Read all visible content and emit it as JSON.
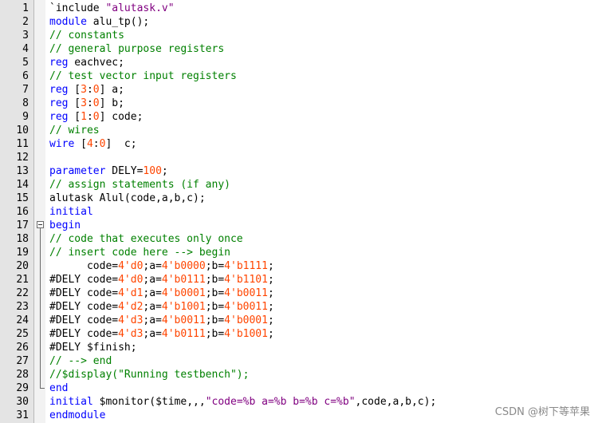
{
  "editor": {
    "language": "verilog",
    "lines": [
      {
        "n": "1",
        "fold": "",
        "tokens": [
          [
            "tx",
            "`include "
          ],
          [
            "str",
            "\"alutask.v\""
          ]
        ]
      },
      {
        "n": "2",
        "fold": "",
        "tokens": [
          [
            "kw",
            "module"
          ],
          [
            "tx",
            " alu_tp();"
          ]
        ]
      },
      {
        "n": "3",
        "fold": "",
        "tokens": [
          [
            "cm",
            "// constants"
          ]
        ]
      },
      {
        "n": "4",
        "fold": "",
        "tokens": [
          [
            "cm",
            "// general purpose registers"
          ]
        ]
      },
      {
        "n": "5",
        "fold": "",
        "tokens": [
          [
            "kw",
            "reg"
          ],
          [
            "tx",
            " eachvec;"
          ]
        ]
      },
      {
        "n": "6",
        "fold": "",
        "tokens": [
          [
            "cm",
            "// test vector input registers"
          ]
        ]
      },
      {
        "n": "7",
        "fold": "",
        "tokens": [
          [
            "kw",
            "reg"
          ],
          [
            "tx",
            " ["
          ],
          [
            "num",
            "3"
          ],
          [
            "tx",
            ":"
          ],
          [
            "num",
            "0"
          ],
          [
            "tx",
            "] a;"
          ]
        ]
      },
      {
        "n": "8",
        "fold": "",
        "tokens": [
          [
            "kw",
            "reg"
          ],
          [
            "tx",
            " ["
          ],
          [
            "num",
            "3"
          ],
          [
            "tx",
            ":"
          ],
          [
            "num",
            "0"
          ],
          [
            "tx",
            "] b;"
          ]
        ]
      },
      {
        "n": "9",
        "fold": "",
        "tokens": [
          [
            "kw",
            "reg"
          ],
          [
            "tx",
            " ["
          ],
          [
            "num",
            "1"
          ],
          [
            "tx",
            ":"
          ],
          [
            "num",
            "0"
          ],
          [
            "tx",
            "] code;"
          ]
        ]
      },
      {
        "n": "10",
        "fold": "",
        "tokens": [
          [
            "cm",
            "// wires"
          ]
        ]
      },
      {
        "n": "11",
        "fold": "",
        "tokens": [
          [
            "kw",
            "wire"
          ],
          [
            "tx",
            " ["
          ],
          [
            "num",
            "4"
          ],
          [
            "tx",
            ":"
          ],
          [
            "num",
            "0"
          ],
          [
            "tx",
            "]  c;"
          ]
        ]
      },
      {
        "n": "12",
        "fold": "",
        "tokens": []
      },
      {
        "n": "13",
        "fold": "",
        "tokens": [
          [
            "kw",
            "parameter"
          ],
          [
            "tx",
            " DELY="
          ],
          [
            "num",
            "100"
          ],
          [
            "tx",
            ";"
          ]
        ]
      },
      {
        "n": "14",
        "fold": "",
        "tokens": [
          [
            "cm",
            "// assign statements (if any)"
          ]
        ]
      },
      {
        "n": "15",
        "fold": "",
        "tokens": [
          [
            "tx",
            "alutask Alul(code,a,b,c);"
          ]
        ]
      },
      {
        "n": "16",
        "fold": "",
        "tokens": [
          [
            "kw",
            "initial"
          ]
        ]
      },
      {
        "n": "17",
        "fold": "open",
        "tokens": [
          [
            "kw",
            "begin"
          ]
        ]
      },
      {
        "n": "18",
        "fold": "line",
        "tokens": [
          [
            "cm",
            "// code that executes only once"
          ]
        ]
      },
      {
        "n": "19",
        "fold": "line",
        "tokens": [
          [
            "cm",
            "// insert code here --> begin"
          ]
        ]
      },
      {
        "n": "20",
        "fold": "line",
        "tokens": [
          [
            "tx",
            "      code="
          ],
          [
            "num",
            "4'd0"
          ],
          [
            "tx",
            ";a="
          ],
          [
            "num",
            "4'b0000"
          ],
          [
            "tx",
            ";b="
          ],
          [
            "num",
            "4'b1111"
          ],
          [
            "tx",
            ";"
          ]
        ]
      },
      {
        "n": "21",
        "fold": "line",
        "tokens": [
          [
            "tx",
            "#DELY code="
          ],
          [
            "num",
            "4'd0"
          ],
          [
            "tx",
            ";a="
          ],
          [
            "num",
            "4'b0111"
          ],
          [
            "tx",
            ";b="
          ],
          [
            "num",
            "4'b1101"
          ],
          [
            "tx",
            ";"
          ]
        ]
      },
      {
        "n": "22",
        "fold": "line",
        "tokens": [
          [
            "tx",
            "#DELY code="
          ],
          [
            "num",
            "4'd1"
          ],
          [
            "tx",
            ";a="
          ],
          [
            "num",
            "4'b0001"
          ],
          [
            "tx",
            ";b="
          ],
          [
            "num",
            "4'b0011"
          ],
          [
            "tx",
            ";"
          ]
        ]
      },
      {
        "n": "23",
        "fold": "line",
        "tokens": [
          [
            "tx",
            "#DELY code="
          ],
          [
            "num",
            "4'd2"
          ],
          [
            "tx",
            ";a="
          ],
          [
            "num",
            "4'b1001"
          ],
          [
            "tx",
            ";b="
          ],
          [
            "num",
            "4'b0011"
          ],
          [
            "tx",
            ";"
          ]
        ]
      },
      {
        "n": "24",
        "fold": "line",
        "tokens": [
          [
            "tx",
            "#DELY code="
          ],
          [
            "num",
            "4'd3"
          ],
          [
            "tx",
            ";a="
          ],
          [
            "num",
            "4'b0011"
          ],
          [
            "tx",
            ";b="
          ],
          [
            "num",
            "4'b0001"
          ],
          [
            "tx",
            ";"
          ]
        ]
      },
      {
        "n": "25",
        "fold": "line",
        "tokens": [
          [
            "tx",
            "#DELY code="
          ],
          [
            "num",
            "4'd3"
          ],
          [
            "tx",
            ";a="
          ],
          [
            "num",
            "4'b0111"
          ],
          [
            "tx",
            ";b="
          ],
          [
            "num",
            "4'b1001"
          ],
          [
            "tx",
            ";"
          ]
        ]
      },
      {
        "n": "26",
        "fold": "line",
        "tokens": [
          [
            "tx",
            "#DELY $finish;"
          ]
        ]
      },
      {
        "n": "27",
        "fold": "line",
        "tokens": [
          [
            "cm",
            "// --> end"
          ]
        ]
      },
      {
        "n": "28",
        "fold": "line",
        "tokens": [
          [
            "cm",
            "//$display(\"Running testbench\");"
          ]
        ]
      },
      {
        "n": "29",
        "fold": "end",
        "tokens": [
          [
            "kw",
            "end"
          ]
        ]
      },
      {
        "n": "30",
        "fold": "",
        "tokens": [
          [
            "kw",
            "initial"
          ],
          [
            "tx",
            " $monitor($time,,,"
          ],
          [
            "str",
            "\"code=%b a=%b b=%b c=%b\""
          ],
          [
            "tx",
            ",code,a,b,c);"
          ]
        ]
      },
      {
        "n": "31",
        "fold": "",
        "tokens": [
          [
            "kw",
            "endmodule"
          ]
        ]
      }
    ]
  },
  "colors": {
    "keyword": "#0000ff",
    "comment": "#008000",
    "number": "#ff4500",
    "string": "#800080",
    "text": "#000000",
    "gutter_bg": "#e4e4e4"
  },
  "watermark": "CSDN @树下等苹果"
}
